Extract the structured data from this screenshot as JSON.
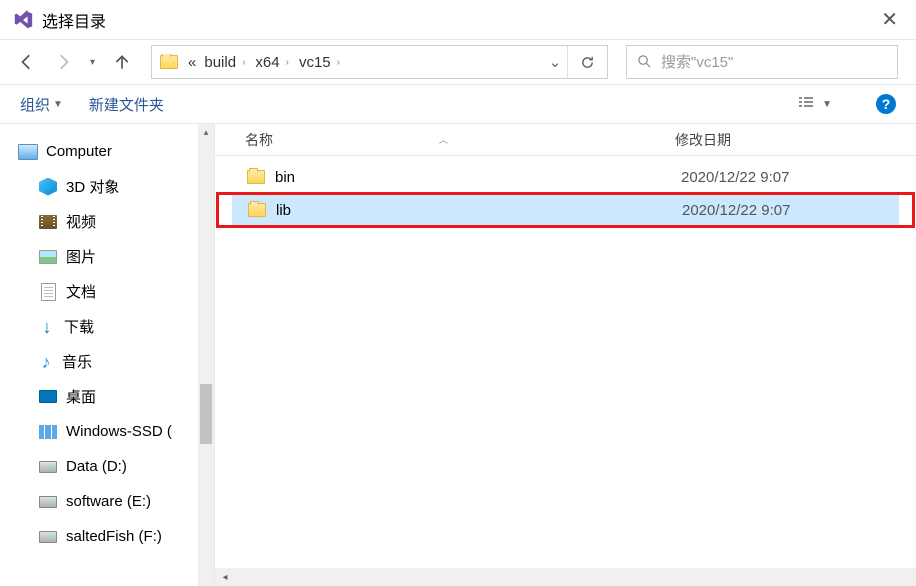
{
  "window": {
    "title": "选择目录"
  },
  "breadcrumb": {
    "ellipsis": "«",
    "items": [
      "build",
      "x64",
      "vc15"
    ]
  },
  "search": {
    "placeholder": "搜索\"vc15\""
  },
  "toolbar": {
    "organize": "组织",
    "new_folder": "新建文件夹"
  },
  "sidebar": {
    "root": "Computer",
    "items": [
      {
        "label": "3D 对象"
      },
      {
        "label": "视频"
      },
      {
        "label": "图片"
      },
      {
        "label": "文档"
      },
      {
        "label": "下载"
      },
      {
        "label": "音乐"
      },
      {
        "label": "桌面"
      },
      {
        "label": "Windows-SSD ("
      },
      {
        "label": "Data (D:)"
      },
      {
        "label": "software (E:)"
      },
      {
        "label": "saltedFish (F:)"
      }
    ]
  },
  "columns": {
    "name": "名称",
    "modified": "修改日期"
  },
  "files": [
    {
      "name": "bin",
      "modified": "2020/12/22 9:07",
      "selected": false,
      "highlighted": false
    },
    {
      "name": "lib",
      "modified": "2020/12/22 9:07",
      "selected": true,
      "highlighted": true
    }
  ]
}
